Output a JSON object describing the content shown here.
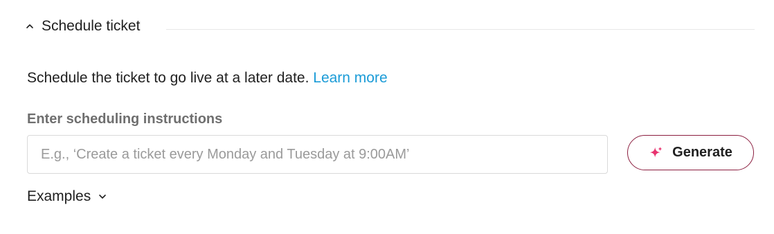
{
  "section": {
    "title": "Schedule ticket",
    "icon": "chevron-up-icon"
  },
  "description": {
    "text": "Schedule the ticket to go live at a later date. ",
    "link_label": "Learn more",
    "link_color": "#1a9bd7"
  },
  "instructions": {
    "label": "Enter scheduling instructions",
    "value": "",
    "placeholder": "E.g., ‘Create a ticket every Monday and Tuesday at 9:00AM’"
  },
  "generate_button": {
    "label": "Generate",
    "icon": "sparkle-icon",
    "accent_color": "#e8336f",
    "border_color": "#8b1e3f"
  },
  "examples": {
    "label": "Examples",
    "icon": "chevron-down-icon"
  }
}
